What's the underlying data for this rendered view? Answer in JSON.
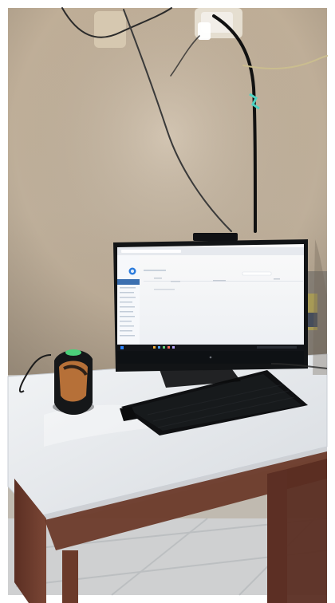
{
  "screen": {
    "app_title": "",
    "page_header": "",
    "sidebar_items": [],
    "table_headers": [],
    "first_row": ""
  },
  "colors": {
    "wall": "#cfc2aa",
    "wall_shadow": "#8f826f",
    "desk_top": "#e9ecef",
    "desk_frame": "#6b3a2a",
    "monitor_bezel": "#121416",
    "screen_bg": "#f3f4f6",
    "sidebar": "#3b6fb0",
    "scanner_light": "#4bd07a",
    "floor": "#d8d8d8"
  },
  "icons": {
    "logo": "circle-logo-icon",
    "windows": "windows-start-icon",
    "taskbar": "taskbar-icons"
  }
}
